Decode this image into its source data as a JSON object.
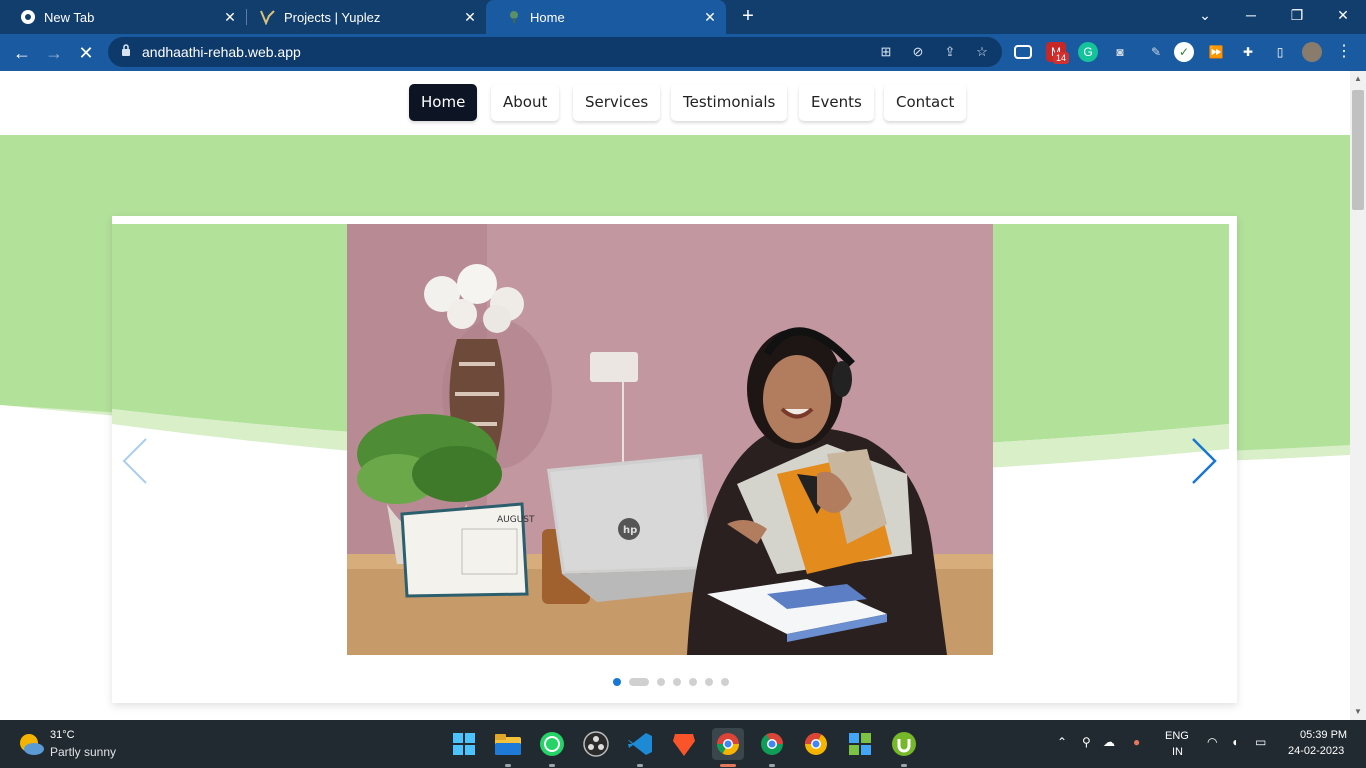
{
  "browser": {
    "tabs": [
      {
        "title": "New Tab",
        "icon": "chrome-icon",
        "active": false
      },
      {
        "title": "Projects | Yuplez",
        "icon": "yuplez-icon",
        "active": false
      },
      {
        "title": "Home",
        "icon": "site-favicon",
        "active": true
      }
    ],
    "url": "andhaathi-rehab.web.app",
    "extension_badge": "14"
  },
  "site": {
    "nav": [
      {
        "label": "Home",
        "active": true
      },
      {
        "label": "About",
        "active": false
      },
      {
        "label": "Services",
        "active": false
      },
      {
        "label": "Testimonials",
        "active": false
      },
      {
        "label": "Events",
        "active": false
      },
      {
        "label": "Contact",
        "active": false
      }
    ],
    "carousel": {
      "slide_count": 7,
      "active_index": 0,
      "calendar_month": "AUGUST",
      "laptop_logo": "hp"
    },
    "colors": {
      "hero_green": "#b2e19a",
      "nav_active": "#0d1424",
      "dot_active": "#1877d2"
    }
  },
  "taskbar": {
    "weather": {
      "temp": "31°C",
      "desc": "Partly sunny"
    },
    "lang": {
      "line1": "ENG",
      "line2": "IN"
    },
    "clock": {
      "time": "05:39 PM",
      "date": "24-02-2023"
    }
  }
}
